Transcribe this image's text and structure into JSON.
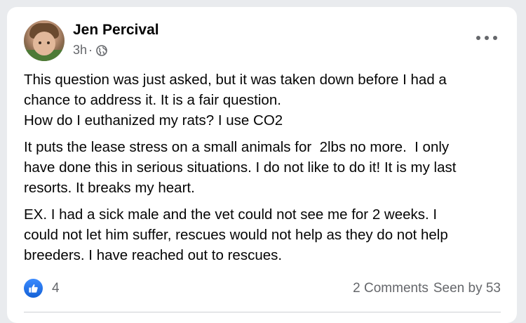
{
  "post": {
    "author": "Jen Percival",
    "time": "3h",
    "separator": "·",
    "privacy_icon": "globe-icon",
    "options_icon": "more-options-icon",
    "paragraphs": [
      [
        "This question was just asked, but it was taken down before I had a",
        "chance to address it. It is a fair question.",
        "How do I euthanized my rats? I use CO2"
      ],
      [
        "It puts the lease stress on a small animals for  2lbs no more.  I only",
        "have done this in serious situations. I do not like to do it! It is my last",
        "resorts. It breaks my heart."
      ],
      [
        "EX. I had a sick male and the vet could not see me for 2 weeks. I",
        "could not let him suffer, rescues would not help as they do not help",
        "breeders. I have reached out to rescues."
      ]
    ]
  },
  "reactions": {
    "icon": "like-icon",
    "count": "4",
    "comments": "2 Comments",
    "seen_by": "Seen by 53"
  },
  "colors": {
    "like_blue": "#1877f2",
    "secondary_text": "#65676b",
    "background": "#e9ebee"
  }
}
